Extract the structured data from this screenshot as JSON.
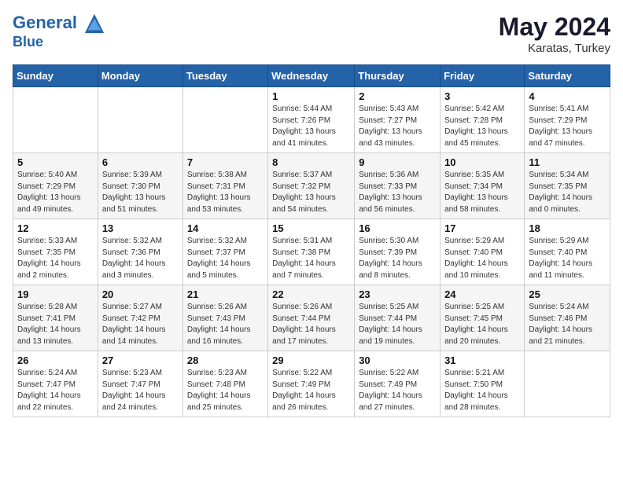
{
  "header": {
    "logo_line1": "General",
    "logo_line2": "Blue",
    "month_year": "May 2024",
    "location": "Karatas, Turkey"
  },
  "weekdays": [
    "Sunday",
    "Monday",
    "Tuesday",
    "Wednesday",
    "Thursday",
    "Friday",
    "Saturday"
  ],
  "weeks": [
    [
      {
        "day": "",
        "info": ""
      },
      {
        "day": "",
        "info": ""
      },
      {
        "day": "",
        "info": ""
      },
      {
        "day": "1",
        "info": "Sunrise: 5:44 AM\nSunset: 7:26 PM\nDaylight: 13 hours\nand 41 minutes."
      },
      {
        "day": "2",
        "info": "Sunrise: 5:43 AM\nSunset: 7:27 PM\nDaylight: 13 hours\nand 43 minutes."
      },
      {
        "day": "3",
        "info": "Sunrise: 5:42 AM\nSunset: 7:28 PM\nDaylight: 13 hours\nand 45 minutes."
      },
      {
        "day": "4",
        "info": "Sunrise: 5:41 AM\nSunset: 7:29 PM\nDaylight: 13 hours\nand 47 minutes."
      }
    ],
    [
      {
        "day": "5",
        "info": "Sunrise: 5:40 AM\nSunset: 7:29 PM\nDaylight: 13 hours\nand 49 minutes."
      },
      {
        "day": "6",
        "info": "Sunrise: 5:39 AM\nSunset: 7:30 PM\nDaylight: 13 hours\nand 51 minutes."
      },
      {
        "day": "7",
        "info": "Sunrise: 5:38 AM\nSunset: 7:31 PM\nDaylight: 13 hours\nand 53 minutes."
      },
      {
        "day": "8",
        "info": "Sunrise: 5:37 AM\nSunset: 7:32 PM\nDaylight: 13 hours\nand 54 minutes."
      },
      {
        "day": "9",
        "info": "Sunrise: 5:36 AM\nSunset: 7:33 PM\nDaylight: 13 hours\nand 56 minutes."
      },
      {
        "day": "10",
        "info": "Sunrise: 5:35 AM\nSunset: 7:34 PM\nDaylight: 13 hours\nand 58 minutes."
      },
      {
        "day": "11",
        "info": "Sunrise: 5:34 AM\nSunset: 7:35 PM\nDaylight: 14 hours\nand 0 minutes."
      }
    ],
    [
      {
        "day": "12",
        "info": "Sunrise: 5:33 AM\nSunset: 7:35 PM\nDaylight: 14 hours\nand 2 minutes."
      },
      {
        "day": "13",
        "info": "Sunrise: 5:32 AM\nSunset: 7:36 PM\nDaylight: 14 hours\nand 3 minutes."
      },
      {
        "day": "14",
        "info": "Sunrise: 5:32 AM\nSunset: 7:37 PM\nDaylight: 14 hours\nand 5 minutes."
      },
      {
        "day": "15",
        "info": "Sunrise: 5:31 AM\nSunset: 7:38 PM\nDaylight: 14 hours\nand 7 minutes."
      },
      {
        "day": "16",
        "info": "Sunrise: 5:30 AM\nSunset: 7:39 PM\nDaylight: 14 hours\nand 8 minutes."
      },
      {
        "day": "17",
        "info": "Sunrise: 5:29 AM\nSunset: 7:40 PM\nDaylight: 14 hours\nand 10 minutes."
      },
      {
        "day": "18",
        "info": "Sunrise: 5:29 AM\nSunset: 7:40 PM\nDaylight: 14 hours\nand 11 minutes."
      }
    ],
    [
      {
        "day": "19",
        "info": "Sunrise: 5:28 AM\nSunset: 7:41 PM\nDaylight: 14 hours\nand 13 minutes."
      },
      {
        "day": "20",
        "info": "Sunrise: 5:27 AM\nSunset: 7:42 PM\nDaylight: 14 hours\nand 14 minutes."
      },
      {
        "day": "21",
        "info": "Sunrise: 5:26 AM\nSunset: 7:43 PM\nDaylight: 14 hours\nand 16 minutes."
      },
      {
        "day": "22",
        "info": "Sunrise: 5:26 AM\nSunset: 7:44 PM\nDaylight: 14 hours\nand 17 minutes."
      },
      {
        "day": "23",
        "info": "Sunrise: 5:25 AM\nSunset: 7:44 PM\nDaylight: 14 hours\nand 19 minutes."
      },
      {
        "day": "24",
        "info": "Sunrise: 5:25 AM\nSunset: 7:45 PM\nDaylight: 14 hours\nand 20 minutes."
      },
      {
        "day": "25",
        "info": "Sunrise: 5:24 AM\nSunset: 7:46 PM\nDaylight: 14 hours\nand 21 minutes."
      }
    ],
    [
      {
        "day": "26",
        "info": "Sunrise: 5:24 AM\nSunset: 7:47 PM\nDaylight: 14 hours\nand 22 minutes."
      },
      {
        "day": "27",
        "info": "Sunrise: 5:23 AM\nSunset: 7:47 PM\nDaylight: 14 hours\nand 24 minutes."
      },
      {
        "day": "28",
        "info": "Sunrise: 5:23 AM\nSunset: 7:48 PM\nDaylight: 14 hours\nand 25 minutes."
      },
      {
        "day": "29",
        "info": "Sunrise: 5:22 AM\nSunset: 7:49 PM\nDaylight: 14 hours\nand 26 minutes."
      },
      {
        "day": "30",
        "info": "Sunrise: 5:22 AM\nSunset: 7:49 PM\nDaylight: 14 hours\nand 27 minutes."
      },
      {
        "day": "31",
        "info": "Sunrise: 5:21 AM\nSunset: 7:50 PM\nDaylight: 14 hours\nand 28 minutes."
      },
      {
        "day": "",
        "info": ""
      }
    ]
  ]
}
